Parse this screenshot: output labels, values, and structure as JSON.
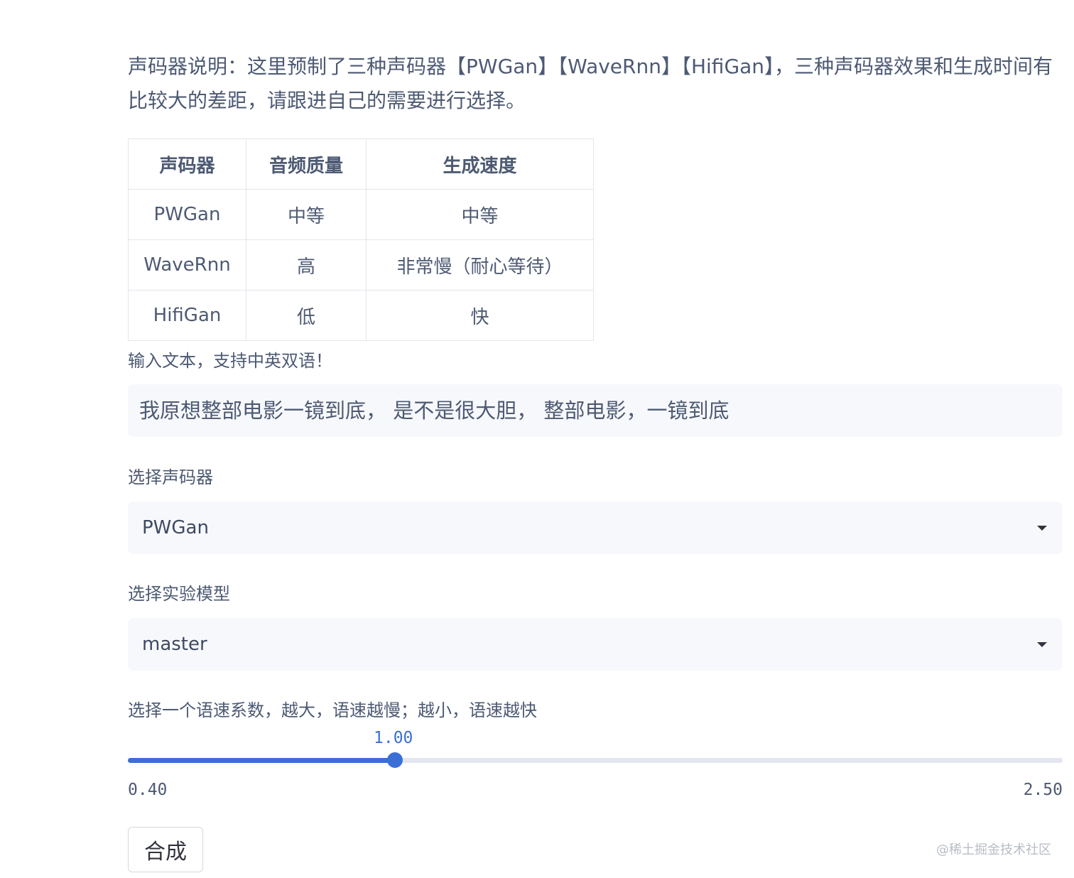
{
  "description": "声码器说明：这里预制了三种声码器【PWGan】【WaveRnn】【HifiGan】，三种声码器效果和生成时间有比较大的差距，请跟进自己的需要进行选择。",
  "table": {
    "headers": [
      "声码器",
      "音频质量",
      "生成速度"
    ],
    "rows": [
      [
        "PWGan",
        "中等",
        "中等"
      ],
      [
        "WaveRnn",
        "高",
        "非常慢（耐心等待）"
      ],
      [
        "HifiGan",
        "低",
        "快"
      ]
    ]
  },
  "text_input": {
    "label": "输入文本，支持中英双语！",
    "value": "我原想整部电影一镜到底， 是不是很大胆， 整部电影，一镜到底"
  },
  "vocoder_select": {
    "label": "选择声码器",
    "value": "PWGan",
    "icon": "chevron-down-icon"
  },
  "model_select": {
    "label": "选择实验模型",
    "value": "master",
    "icon": "chevron-down-icon"
  },
  "speed_slider": {
    "label": "选择一个语速系数，越大，语速越慢；越小，语速越快",
    "value": "1.00",
    "min": "0.40",
    "max": "2.50",
    "fraction": 0.2857,
    "accent_color": "#3b6fd8"
  },
  "submit_button": {
    "label": "合成"
  },
  "watermark": "@稀土掘金技术社区"
}
